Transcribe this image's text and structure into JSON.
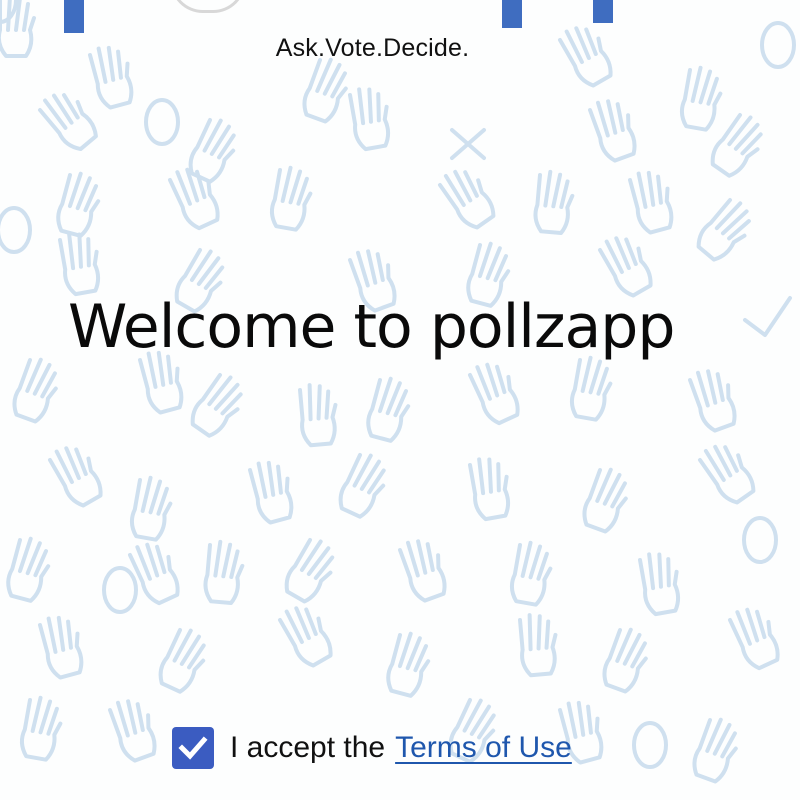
{
  "app": {
    "tagline": "Ask.Vote.Decide.",
    "welcome_text": "Welcome to pollzapp"
  },
  "terms": {
    "checkbox_checked": true,
    "accept_prefix": "I accept the",
    "link_label": "Terms of Use"
  },
  "colors": {
    "accent": "#3b5cc1",
    "link": "#1f57ad",
    "logo_blue": "#3f6dc0",
    "pattern": "#cfe0ef"
  },
  "icons": {
    "checkbox": "checkmark-icon",
    "background": "hands-doodle-pattern"
  }
}
